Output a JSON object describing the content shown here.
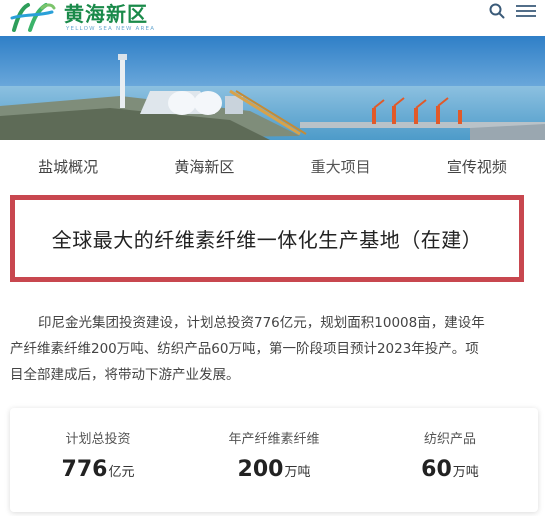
{
  "header": {
    "logo_title": "黄海新区",
    "logo_subtitle": "YELLOW SEA NEW AREA",
    "icons": {
      "search": "search-icon",
      "menu": "menu-icon"
    },
    "brand_color": "#1a8a4a"
  },
  "tabs": [
    {
      "label": "盐城概况",
      "active": false
    },
    {
      "label": "黄海新区",
      "active": false
    },
    {
      "label": "重大项目",
      "active": true
    },
    {
      "label": "宣传视频",
      "active": false
    }
  ],
  "project": {
    "title": "全球最大的纤维素纤维一体化生产基地（在建）",
    "border_color": "#c8474f",
    "description_lines": [
      "印尼金光集团投资建设，计划总投资776亿元，规划面积10008亩，建设年",
      "产纤维素纤维200万吨、纺织产品60万吨，第一阶段项目预计2023年投产。项",
      "目全部建成后，将带动下游产业发展。"
    ]
  },
  "stats": [
    {
      "label": "计划总投资",
      "value": "776",
      "unit": "亿元"
    },
    {
      "label": "年产纤维素纤维",
      "value": "200",
      "unit": "万吨"
    },
    {
      "label": "纺织产品",
      "value": "60",
      "unit": "万吨"
    }
  ]
}
